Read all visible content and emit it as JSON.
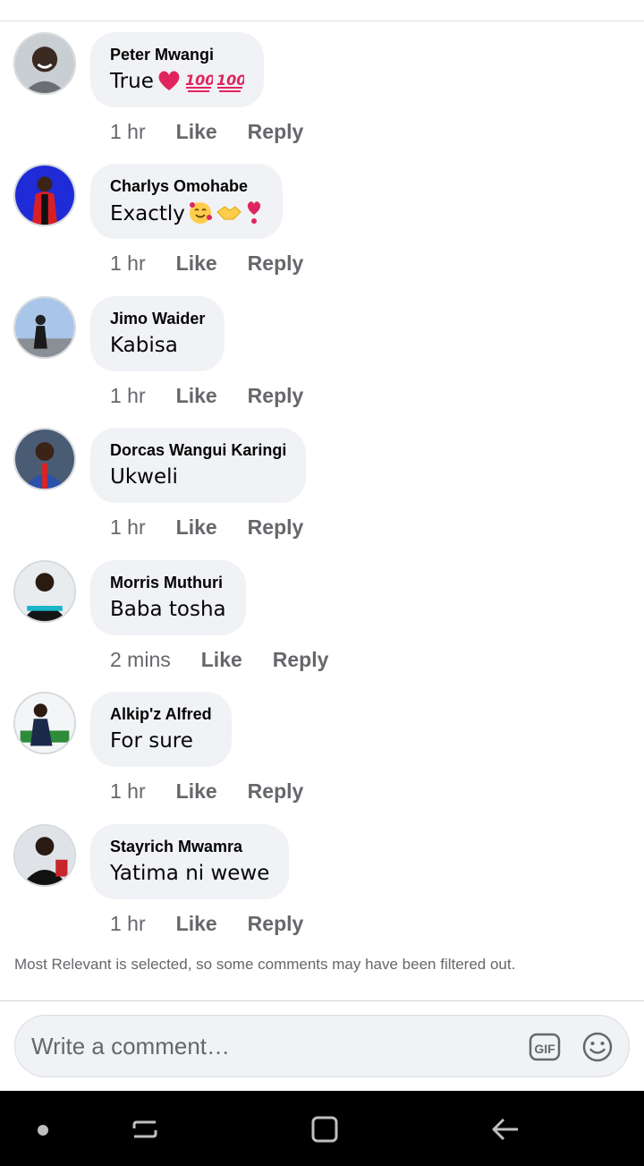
{
  "comments": [
    {
      "author": "Peter Mwangi",
      "text": "True",
      "time": "1 hr",
      "like": "Like",
      "reply": "Reply",
      "emoji": [
        "heart-icon",
        "hundred-points-icon",
        "hundred-points-icon"
      ]
    },
    {
      "author": "Charlys Omohabe",
      "text": "Exactly",
      "time": "1 hr",
      "like": "Like",
      "reply": "Reply",
      "emoji": [
        "smiling-face-with-hearts-icon",
        "handshake-icon",
        "heart-exclamation-icon"
      ]
    },
    {
      "author": "Jimo Waider",
      "text": "Kabisa",
      "time": "1 hr",
      "like": "Like",
      "reply": "Reply"
    },
    {
      "author": "Dorcas Wangui Karingi",
      "text": "Ukweli",
      "time": "1 hr",
      "like": "Like",
      "reply": "Reply"
    },
    {
      "author": "Morris Muthuri",
      "text": "Baba tosha",
      "time": "2 mins",
      "like": "Like",
      "reply": "Reply"
    },
    {
      "author": "Alkip'z Alfred",
      "text": "For sure",
      "time": "1 hr",
      "like": "Like",
      "reply": "Reply"
    },
    {
      "author": "Stayrich Mwamra",
      "text": "Yatima ni wewe",
      "time": "1 hr",
      "like": "Like",
      "reply": "Reply"
    }
  ],
  "filter_note": "Most Relevant is selected, so some comments may have been filtered out.",
  "composer": {
    "placeholder": "Write a comment…",
    "gif_icon": "gif-icon",
    "emoji_icon": "smiley-icon"
  },
  "colors": {
    "bubble": "#f0f2f5",
    "meta_text": "#65676b",
    "heart": "#e0245e",
    "hundred": "#e0245e"
  }
}
